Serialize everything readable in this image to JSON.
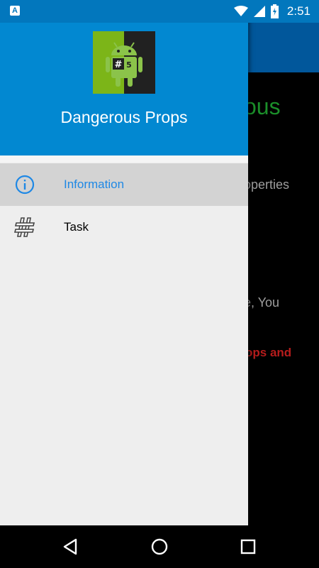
{
  "status_bar": {
    "time": "2:51",
    "left_icon": "A",
    "icons": [
      "wifi-icon",
      "signal-icon",
      "battery-charging-icon"
    ]
  },
  "background_app": {
    "title_fragment": "ous",
    "line1_fragment": "operties",
    "line2_fragment": "e, You",
    "warning_fragment": "ops and"
  },
  "drawer": {
    "header": {
      "title": "Dangerous Props",
      "logo_badge": "#",
      "logo_number": "5"
    },
    "items": [
      {
        "label": "Information",
        "icon": "info-icon",
        "selected": true
      },
      {
        "label": "Task",
        "icon": "hashtag-icon",
        "selected": false
      }
    ]
  },
  "nav_bar": {
    "buttons": [
      "back-button",
      "home-button",
      "recents-button"
    ]
  },
  "colors": {
    "status_bar": "#0277bd",
    "drawer_header": "#0288d1",
    "app_toolbar": "#01579b",
    "selected_item_bg": "#d3d3d3",
    "selected_item_text": "#1e88e5",
    "background_title": "#1b8f2a",
    "background_warning": "#b71c1c"
  }
}
